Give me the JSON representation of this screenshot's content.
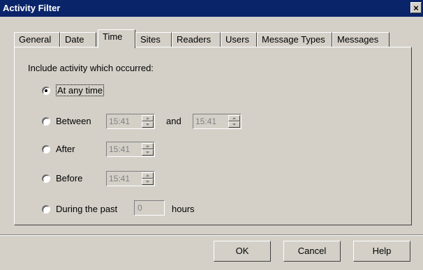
{
  "window": {
    "title": "Activity Filter",
    "close_symbol": "×"
  },
  "tabs": [
    {
      "label": "General"
    },
    {
      "label": "Date"
    },
    {
      "label": "Time",
      "selected": true
    },
    {
      "label": "Sites"
    },
    {
      "label": "Readers"
    },
    {
      "label": "Users"
    },
    {
      "label": "Message Types"
    },
    {
      "label": "Messages"
    }
  ],
  "panel": {
    "heading": "Include activity which occurred:",
    "options": {
      "any_time": {
        "label": "At any time",
        "selected": true
      },
      "between": {
        "label": "Between",
        "start_value": "15:41",
        "conjunction": "and",
        "end_value": "15:41"
      },
      "after": {
        "label": "After",
        "value": "15:41"
      },
      "before": {
        "label": "Before",
        "value": "15:41"
      },
      "during": {
        "label": "During the past",
        "value": "0",
        "unit": "hours"
      }
    }
  },
  "buttons": {
    "ok": "OK",
    "cancel": "Cancel",
    "help": "Help"
  }
}
